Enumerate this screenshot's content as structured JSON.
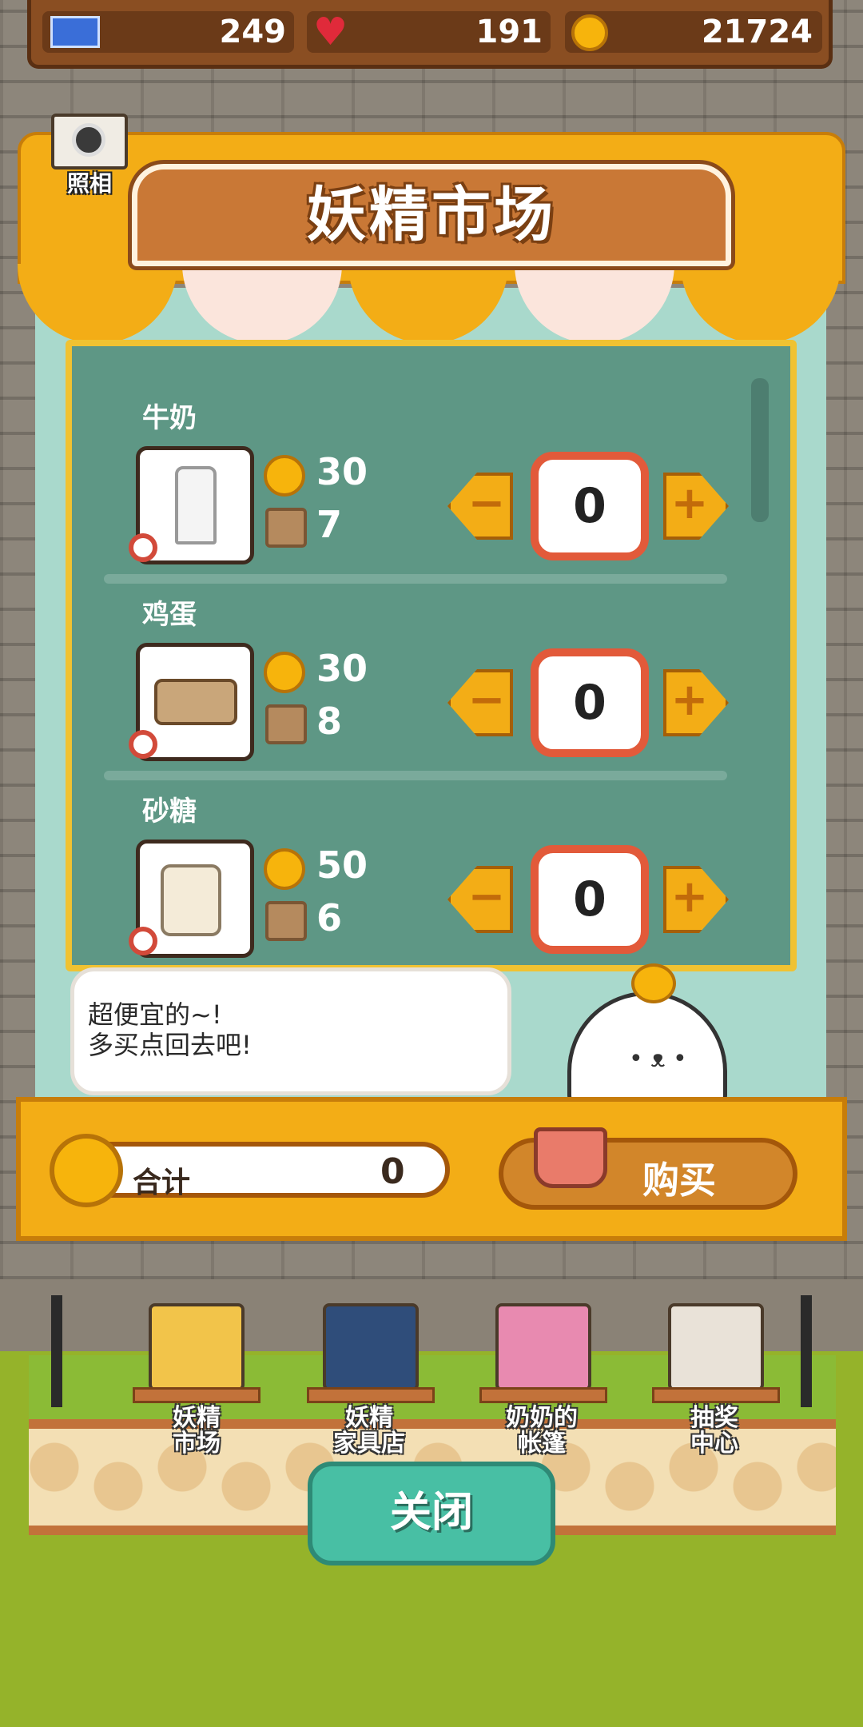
{
  "resources": {
    "tickets": "249",
    "hearts": "191",
    "coins": "21724"
  },
  "camera": {
    "label": "照相"
  },
  "shop": {
    "title": "妖精市场"
  },
  "items": [
    {
      "name": "牛奶",
      "coin_price": "30",
      "material_count": "7",
      "quantity": "0"
    },
    {
      "name": "鸡蛋",
      "coin_price": "30",
      "material_count": "8",
      "quantity": "0"
    },
    {
      "name": "砂糖",
      "coin_price": "50",
      "material_count": "6",
      "quantity": "0"
    }
  ],
  "speech": {
    "text": "超便宜的~!\n多买点回去吧!"
  },
  "checkout": {
    "total_label": "合计",
    "total_value": "0",
    "buy_label": "购买"
  },
  "shops_nav": [
    {
      "label": "妖精\n市场",
      "color": "#f2c44a"
    },
    {
      "label": "妖精\n家具店",
      "color": "#2f4d7a"
    },
    {
      "label": "奶奶的\n帐篷",
      "color": "#e88ab0"
    },
    {
      "label": "抽奖\n中心",
      "color": "#e9e2d8"
    }
  ],
  "close_label": "关闭",
  "colors": {
    "accent": "#f3ad16",
    "board": "#5e9785",
    "close_button": "#48bfa4",
    "quantity_border": "#e25a3a"
  }
}
